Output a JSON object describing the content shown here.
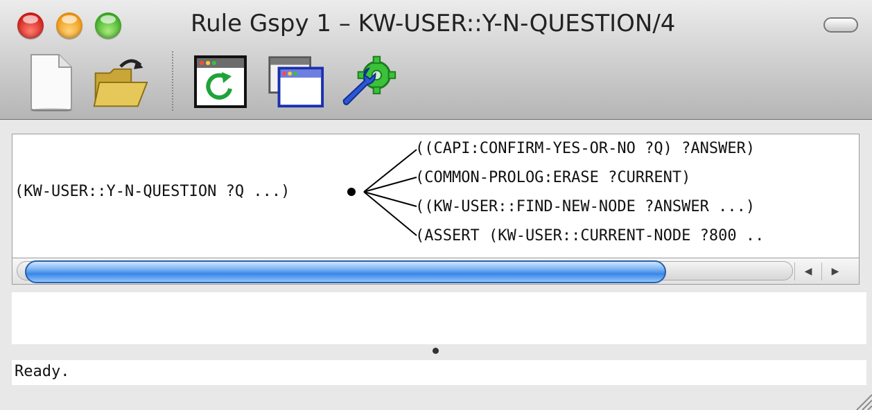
{
  "window": {
    "title": "Rule Gspy 1 – KW-USER::Y-N-QUESTION/4"
  },
  "toolbar": {
    "buttons": [
      {
        "name": "new-document",
        "icon": "blank-page-icon"
      },
      {
        "name": "open-folder",
        "icon": "open-folder-icon"
      },
      {
        "name": "refresh-window",
        "icon": "refresh-window-icon"
      },
      {
        "name": "new-window",
        "icon": "stacked-windows-icon"
      },
      {
        "name": "preferences",
        "icon": "wrench-gear-icon"
      }
    ]
  },
  "rule_tree": {
    "head": "(KW-USER::Y-N-QUESTION ?Q ...)",
    "branches": [
      "((CAPI:CONFIRM-YES-OR-NO ?Q) ?ANSWER)",
      "(COMMON-PROLOG:ERASE ?CURRENT)",
      "((KW-USER::FIND-NEW-NODE ?ANSWER ...)",
      "(ASSERT (KW-USER::CURRENT-NODE ?800 .."
    ]
  },
  "scrollbar": {
    "position_fraction": 0.83
  },
  "status": {
    "text": "Ready."
  },
  "colors": {
    "close": "#d3201a",
    "minimize": "#f09a12",
    "zoom": "#3fae28",
    "scroll_thumb": "#3b86e6"
  }
}
